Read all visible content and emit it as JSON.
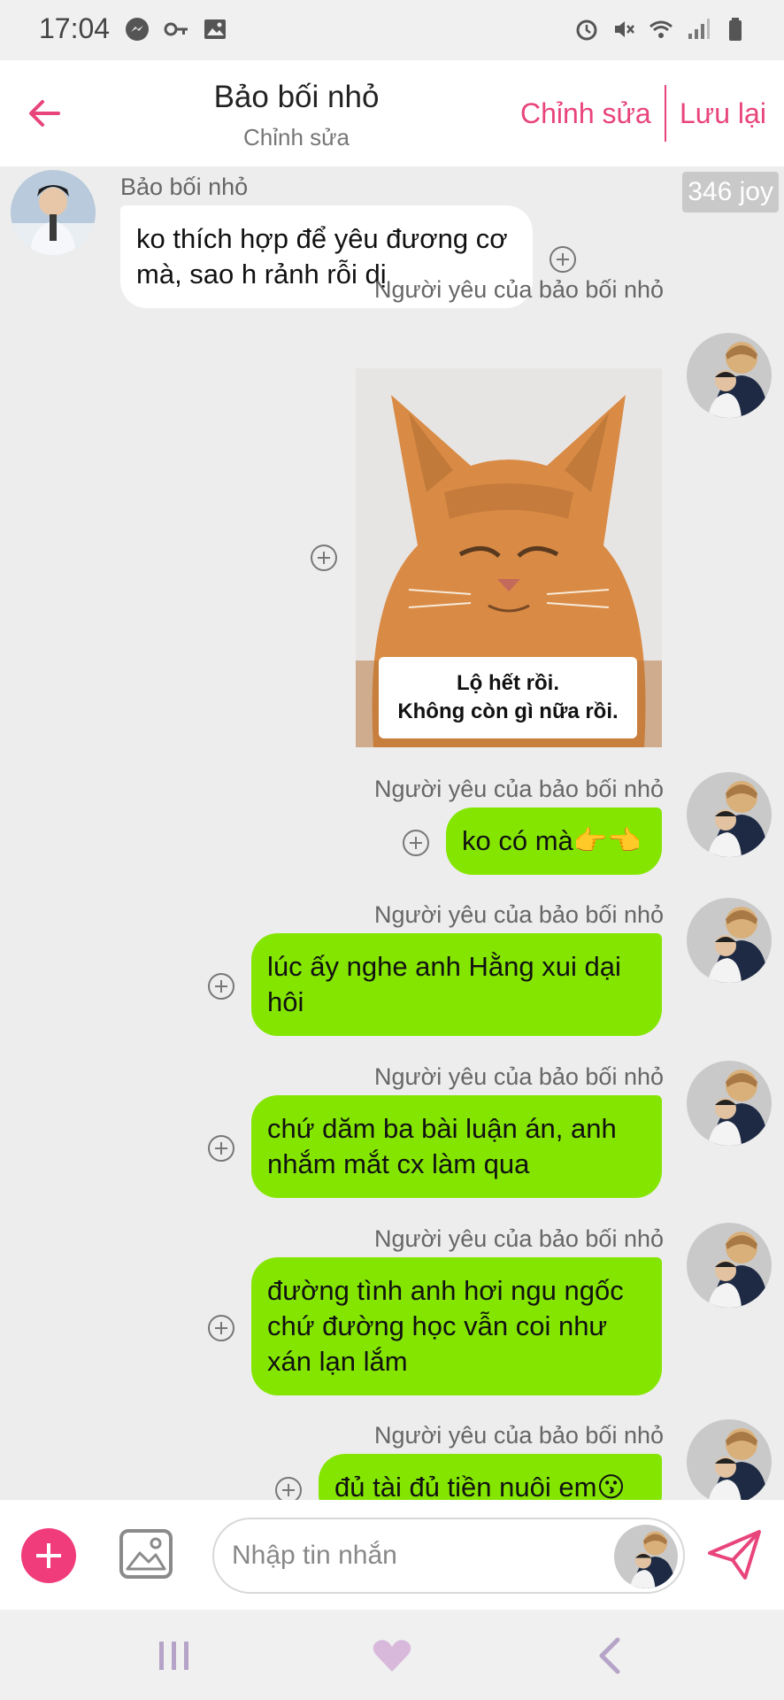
{
  "status": {
    "time": "17:04",
    "left_icons": [
      "messenger-icon",
      "key-icon",
      "image-icon"
    ],
    "right_icons": [
      "alarm-icon",
      "mute-icon",
      "wifi-icon",
      "signal-icon",
      "battery-icon"
    ]
  },
  "header": {
    "title": "Bảo bối nhỏ",
    "subtitle": "Chỉnh sửa",
    "edit_label": "Chỉnh sửa",
    "save_label": "Lưu lại",
    "accent": "#e8457b"
  },
  "chat": {
    "joy_badge": "346 joy",
    "messages": [
      {
        "sender": "Bảo bối nhỏ",
        "direction": "incoming",
        "lines": [
          "ko thích hợp để yêu đương cơ",
          "mà, sao h rảnh rỗi dị"
        ]
      },
      {
        "sender": "Người yêu của bảo bối nhỏ",
        "direction": "outgoing",
        "type": "image",
        "caption": [
          "Lộ hết rồi.",
          "Không còn gì nữa rồi."
        ]
      },
      {
        "sender": "Người yêu của bảo bối nhỏ",
        "direction": "outgoing",
        "lines": [
          "ko có mà👉👈"
        ]
      },
      {
        "sender": "Người yêu của bảo bối nhỏ",
        "direction": "outgoing",
        "lines": [
          "lúc ấy nghe anh Hằng xui dại",
          "hôi"
        ]
      },
      {
        "sender": "Người yêu của bảo bối nhỏ",
        "direction": "outgoing",
        "lines": [
          "chứ dăm ba bài luận án, anh",
          "nhắm mắt cx làm qua"
        ]
      },
      {
        "sender": "Người yêu của bảo bối nhỏ",
        "direction": "outgoing",
        "lines": [
          "đường tình anh hơi ngu ngốc",
          "chứ đường học vẫn coi như",
          "xán lạn lắm"
        ]
      },
      {
        "sender": "Người yêu của bảo bối nhỏ",
        "direction": "outgoing",
        "lines": [
          "đủ tài đủ tiền nuôi em😗"
        ]
      }
    ],
    "bubble_out_color": "#84e600",
    "bubble_in_color": "#ffffff"
  },
  "input": {
    "placeholder": "Nhập tin nhắn",
    "add_color": "#f03c7a"
  },
  "nav": {
    "items": [
      "recents-icon",
      "home-heart-icon",
      "back-icon"
    ]
  }
}
